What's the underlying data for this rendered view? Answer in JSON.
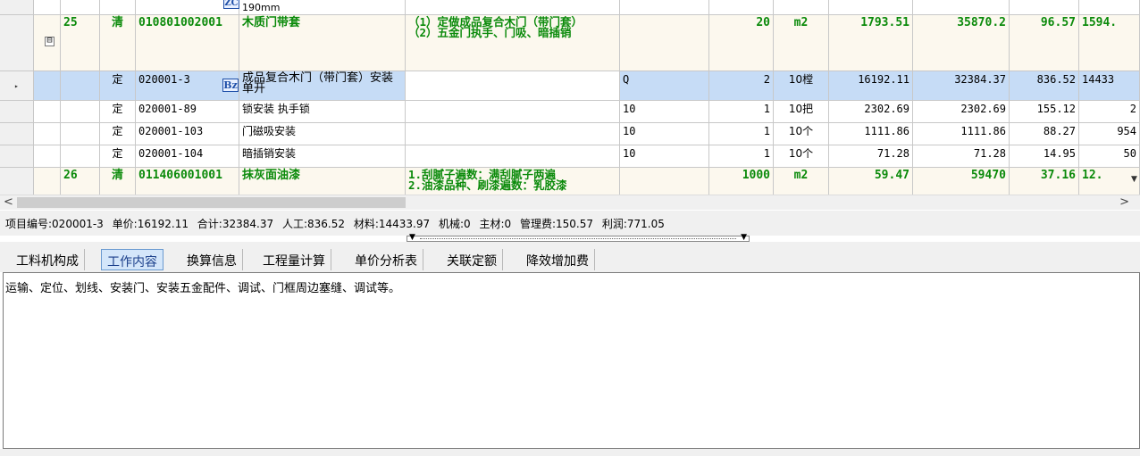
{
  "grid": {
    "partial_top": {
      "name_line": "190mm",
      "icon": "ZC"
    },
    "rows": [
      {
        "kind": "qd",
        "no": "25",
        "type": "清",
        "code": "010801002001",
        "name": "木质门带套",
        "desc": "（1）定做成品复合木门（带门套）\n（2）五金门执手、门吸、暗插销",
        "expr": "",
        "qty": "20",
        "unit": "m2",
        "price": "1793.51",
        "total": "35870.2",
        "labor": "96.57",
        "material": "1594."
      },
      {
        "kind": "de",
        "selected": true,
        "no": "",
        "type": "定",
        "code": "020001-3",
        "name": "成品复合木门（带门套）安装 单开",
        "desc": "",
        "expr": "Q",
        "qty": "2",
        "unit": "10樘",
        "price": "16192.11",
        "total": "32384.37",
        "labor": "836.52",
        "material": "14433"
      },
      {
        "kind": "de",
        "no": "",
        "type": "定",
        "code": "020001-89",
        "name": "锁安装 执手锁",
        "desc": "",
        "expr": "10",
        "qty": "1",
        "unit": "10把",
        "price": "2302.69",
        "total": "2302.69",
        "labor": "155.12",
        "material": "2"
      },
      {
        "kind": "de",
        "no": "",
        "type": "定",
        "code": "020001-103",
        "name": "门磁吸安装",
        "desc": "",
        "expr": "10",
        "qty": "1",
        "unit": "10个",
        "price": "1111.86",
        "total": "1111.86",
        "labor": "88.27",
        "material": "954"
      },
      {
        "kind": "de",
        "no": "",
        "type": "定",
        "code": "020001-104",
        "name": "暗插销安装",
        "desc": "",
        "expr": "10",
        "qty": "1",
        "unit": "10个",
        "price": "71.28",
        "total": "71.28",
        "labor": "14.95",
        "material": "50"
      },
      {
        "kind": "qd",
        "no": "26",
        "type": "清",
        "code": "011406001001",
        "name": "抹灰面油漆",
        "desc": "1.刮腻子遍数：满刮腻子两遍\n2.油漆品种、刷漆遍数：乳胶漆",
        "expr": "",
        "qty": "1000",
        "unit": "m2",
        "price": "59.47",
        "total": "59470",
        "labor": "37.16",
        "material": "12."
      }
    ],
    "selected_row_icon": "Bz",
    "collapse_glyph": "⊟",
    "pointer_glyph": "▸"
  },
  "scrollbar": {
    "left_arrow": "<",
    "right_arrow": ">"
  },
  "status": {
    "item_code": "项目编号:020001-3",
    "unit_price": "单价:16192.11",
    "total": "合计:32384.37",
    "labor": "人工:836.52",
    "material": "材料:14433.97",
    "machine": "机械:0",
    "main_material": "主材:0",
    "management": "管理费:150.57",
    "profit": "利润:771.05"
  },
  "tabs": {
    "items": [
      "工料机构成",
      "工作内容",
      "换算信息",
      "工程量计算",
      "单价分析表",
      "关联定额",
      "降效增加费"
    ],
    "active_index": 1
  },
  "content": {
    "text": "运输、定位、划线、安装门、安装五金配件、调试、门框周边塞缝、调试等。"
  },
  "colors": {
    "bill_row_text": "#0a8a0a",
    "bill_row_bg": "#fcf8ee",
    "selected_row_bg": "#c6dcf6",
    "active_tab_bg": "#d4e6fa"
  }
}
